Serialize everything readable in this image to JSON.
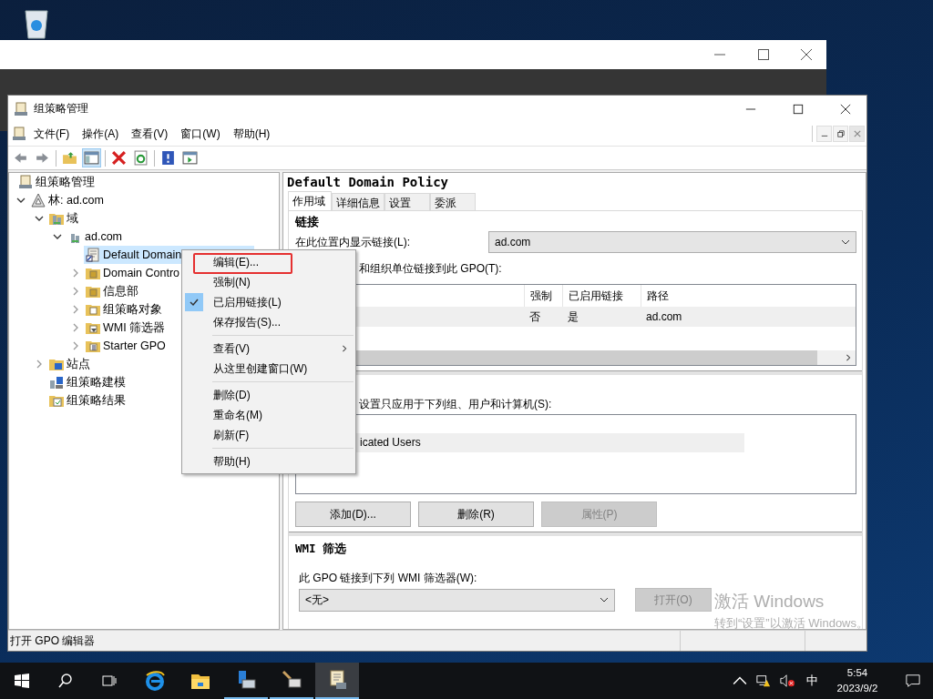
{
  "window": {
    "title": "组策略管理"
  },
  "menu_bar": [
    "文件(F)",
    "操作(A)",
    "查看(V)",
    "窗口(W)",
    "帮助(H)"
  ],
  "tree": [
    {
      "label": "组策略管理",
      "kind": "root",
      "selected": false,
      "children": [
        {
          "label": "林: ad.com",
          "kind": "forest",
          "expanded": true,
          "selected": false,
          "children": [
            {
              "label": "域",
              "kind": "domains",
              "expanded": true,
              "selected": false,
              "children": [
                {
                  "label": "ad.com",
                  "kind": "domain",
                  "expanded": true,
                  "selected": false,
                  "children": [
                    {
                      "label": "Default Domain",
                      "kind": "gpo-link",
                      "selected": true
                    },
                    {
                      "label": "Domain Contro",
                      "kind": "ou",
                      "expanded": false,
                      "selected": false
                    },
                    {
                      "label": "信息部",
                      "kind": "ou",
                      "expanded": false,
                      "selected": false
                    },
                    {
                      "label": "组策略对象",
                      "kind": "gpo-folder",
                      "expanded": false,
                      "selected": false
                    },
                    {
                      "label": "WMI 筛选器",
                      "kind": "wmi",
                      "expanded": false,
                      "selected": false
                    },
                    {
                      "label": "Starter GPO",
                      "kind": "starter",
                      "expanded": false,
                      "selected": false
                    }
                  ]
                }
              ]
            },
            {
              "label": "站点",
              "kind": "sites",
              "expanded": false,
              "selected": false
            },
            {
              "label": "组策略建模",
              "kind": "modeling",
              "selected": false
            },
            {
              "label": "组策略结果",
              "kind": "results",
              "selected": false
            }
          ]
        }
      ]
    }
  ],
  "details": {
    "title": "Default Domain Policy",
    "tabs": [
      {
        "label": "作用域",
        "selected": true
      },
      {
        "label": "详细信息",
        "selected": false
      },
      {
        "label": "设置",
        "selected": false
      },
      {
        "label": "委派",
        "selected": false
      }
    ],
    "links_heading": "链接",
    "location_label": "在此位置内显示链接(L):",
    "location_value": "ad.com",
    "linked_label": "和组织单位链接到此 GPO(T):",
    "links_table": {
      "columns": [
        "强制",
        "已启用链接",
        "路径"
      ],
      "rows": [
        {
          "cells": [
            "否",
            "是",
            "ad.com"
          ],
          "selected": true
        }
      ]
    },
    "filter_label": "设置只应用于下列组、用户和计算机(S):",
    "filter_list": [
      {
        "label": "icated Users",
        "selected": true
      }
    ],
    "filter_buttons": [
      {
        "label": "添加(D)...",
        "disabled": false
      },
      {
        "label": "删除(R)",
        "disabled": false
      },
      {
        "label": "属性(P)",
        "disabled": true
      }
    ],
    "wmi_heading": "WMI 筛选",
    "wmi_label": "此 GPO 链接到下列 WMI 筛选器(W):",
    "wmi_value": "<无>",
    "wmi_button": {
      "label": "打开(O)",
      "disabled": true
    }
  },
  "status_bar": "打开 GPO 编辑器",
  "context_menu": {
    "groups": [
      [
        {
          "label": "编辑(E)...",
          "checked": false,
          "submenu": false,
          "outlined": true
        },
        {
          "label": "强制(N)",
          "checked": false,
          "submenu": false,
          "outlined": false
        },
        {
          "label": "已启用链接(L)",
          "checked": true,
          "submenu": false,
          "outlined": false
        },
        {
          "label": "保存报告(S)...",
          "checked": false,
          "submenu": false,
          "outlined": false
        }
      ],
      [
        {
          "label": "查看(V)",
          "checked": false,
          "submenu": true,
          "outlined": false
        },
        {
          "label": "从这里创建窗口(W)",
          "checked": false,
          "submenu": false,
          "outlined": false
        }
      ],
      [
        {
          "label": "删除(D)",
          "checked": false,
          "submenu": false,
          "outlined": false
        },
        {
          "label": "重命名(M)",
          "checked": false,
          "submenu": false,
          "outlined": false
        },
        {
          "label": "刷新(F)",
          "checked": false,
          "submenu": false,
          "outlined": false
        }
      ],
      [
        {
          "label": "帮助(H)",
          "checked": false,
          "submenu": false,
          "outlined": false
        }
      ]
    ]
  },
  "taskbar": {
    "apps": [
      {
        "kind": "browser",
        "running": false,
        "active": false
      },
      {
        "kind": "folder",
        "running": false,
        "active": false
      },
      {
        "kind": "server",
        "running": true,
        "active": false
      },
      {
        "kind": "tools",
        "running": true,
        "active": false
      },
      {
        "kind": "scroll",
        "running": true,
        "active": true
      }
    ],
    "ime": "中",
    "time": "5:54",
    "date": "2023/9/2"
  },
  "activation": {
    "title": "激活 Windows",
    "text": "转到“设置”以激活 Windows。"
  }
}
